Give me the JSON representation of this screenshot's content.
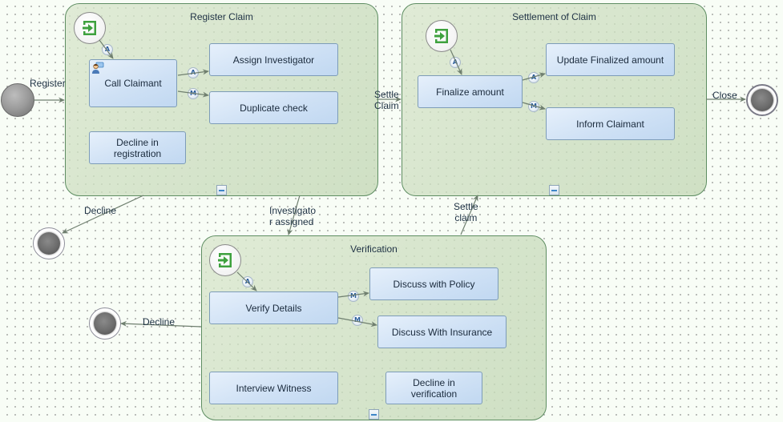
{
  "diagram": {
    "start_event": {
      "label": "Register"
    },
    "groups": {
      "register_claim": {
        "title": "Register Claim",
        "tasks": {
          "call_claimant": "Call Claimant",
          "assign_investigator": "Assign Investigator",
          "duplicate_check": "Duplicate check",
          "decline_in_registration": "Decline in\nregistration"
        },
        "badges": {
          "start_to_call": "A",
          "call_to_assign": "A",
          "call_to_duplicate": "M"
        }
      },
      "settlement_of_claim": {
        "title": "Settlement of Claim",
        "tasks": {
          "finalize_amount": "Finalize amount",
          "update_finalized_amount": "Update Finalized amount",
          "inform_claimant": "Inform Claimant"
        },
        "badges": {
          "start_to_finalize": "A",
          "finalize_to_update": "A",
          "finalize_to_inform": "M"
        }
      },
      "verification": {
        "title": "Verification",
        "tasks": {
          "verify_details": "Verify Details",
          "discuss_with_policy": "Discuss with Policy",
          "discuss_with_insurance": "Discuss With Insurance",
          "interview_witness": "Interview Witness",
          "decline_in_verification": "Decline in\nverification"
        },
        "badges": {
          "start_to_verify": "A",
          "verify_to_policy": "M",
          "verify_to_insurance": "M"
        }
      }
    },
    "edges": {
      "settle_claim_top": "Settle\nClaim",
      "close": "Close",
      "decline_registration": "Decline",
      "investigator_assigned": "Investigato\nr assigned",
      "settle_claim_bottom": "Settle\nclaim",
      "decline_verification": "Decline"
    }
  }
}
